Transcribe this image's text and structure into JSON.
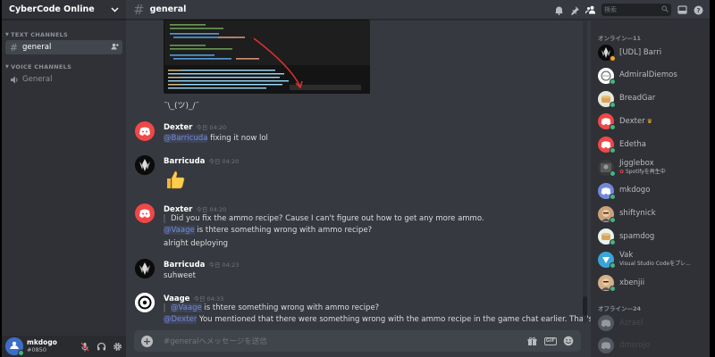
{
  "sidebar": {
    "server_name": "CyberCode Online",
    "text_channels_label": "TEXT CHANNELS",
    "voice_channels_label": "VOICE CHANNELS",
    "text_channel": "general",
    "voice_channel": "General"
  },
  "user": {
    "name": "mkdogo",
    "tag": "#0850"
  },
  "header": {
    "channel": "general",
    "search_placeholder": "検索"
  },
  "messages": {
    "shrug": "¯\\_(ツ)_/¯",
    "m1": {
      "author": "Dexter",
      "time": "今日 04:20",
      "mention": "@Barricuda",
      "text": " fixing it now lol"
    },
    "m2": {
      "author": "Barricuda",
      "time": "今日 04:20",
      "emoji": "👍"
    },
    "m3": {
      "author": "Dexter",
      "time": "今日 04:20",
      "quote": "Did you fix the ammo recipe? Cause I can't figure out how to get any more ammo.",
      "mention": "@Vaage",
      "text": " is thtere something wrong with ammo recipe?",
      "line3": "alright deploying"
    },
    "m4": {
      "author": "Barricuda",
      "time": "今日 04:23",
      "text": "suhweet"
    },
    "m5": {
      "author": "Vaage",
      "time": "今日 04:33",
      "q_mention": "@Vaage",
      "q_text": " is thtere something wrong with ammo recipe?",
      "mention": "@Dexter",
      "text": " You mentioned that there were something wrong with the ammo recipe in the game chat earlier. That's"
    }
  },
  "composer": {
    "placeholder": "#generalへメッセージを送信",
    "gif_label": "GIF"
  },
  "members": {
    "online_label": "オンライン—11",
    "offline_label": "オフライン—24",
    "list": [
      {
        "name": "[UDL] Barri",
        "sub": ""
      },
      {
        "name": "AdmiralDiemos",
        "sub": ""
      },
      {
        "name": "BreadGar",
        "sub": ""
      },
      {
        "name": "Dexter",
        "sub": ""
      },
      {
        "name": "Edetha",
        "sub": ""
      },
      {
        "name": "Jigglebox",
        "sub": "Spotifyを再生中"
      },
      {
        "name": "mkdogo",
        "sub": ""
      },
      {
        "name": "shiftynick",
        "sub": ""
      },
      {
        "name": "spamdog",
        "sub": ""
      },
      {
        "name": "Vak",
        "sub": "Visual Studio Codeをプレ..."
      },
      {
        "name": "xbenjii",
        "sub": ""
      }
    ],
    "offline": [
      {
        "name": "Azrael"
      },
      {
        "name": "dmsrojo"
      }
    ]
  },
  "colors": {
    "accent": "#7289da",
    "online": "#43b581",
    "idle": "#faa61a",
    "discord_red": "#f04747"
  }
}
